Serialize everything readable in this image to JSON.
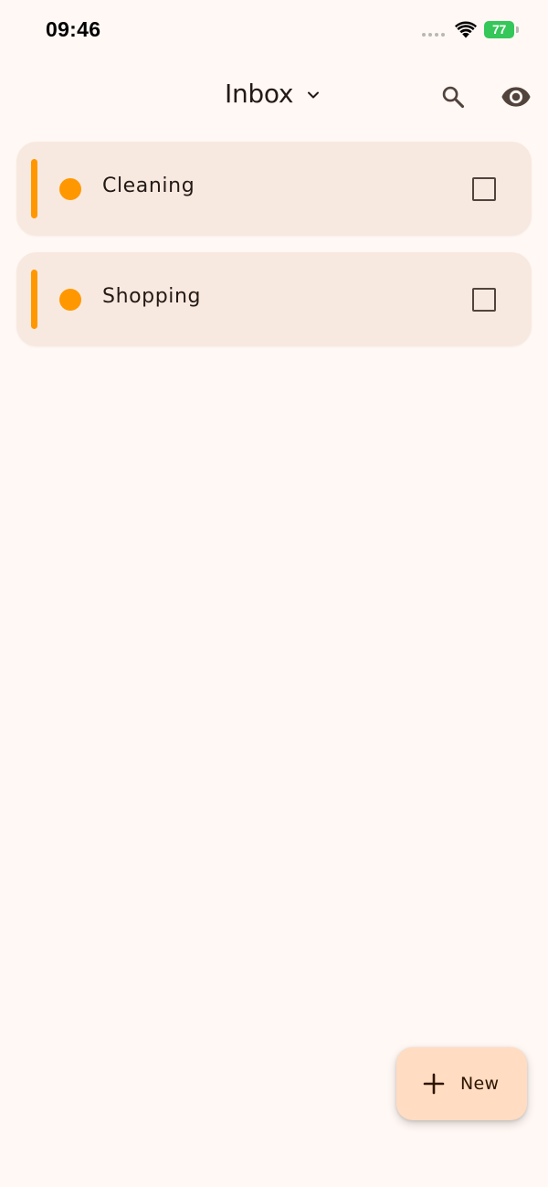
{
  "status_bar": {
    "time": "09:46",
    "battery": "77",
    "battery_color": "#35c759"
  },
  "app_bar": {
    "title": "Inbox",
    "title_dropdown_icon": "chevron-down-icon",
    "actions": [
      {
        "icon": "search-icon"
      },
      {
        "icon": "eye-icon"
      }
    ]
  },
  "lists": [
    {
      "label": "Cleaning",
      "color": "#ff9800",
      "checked": false
    },
    {
      "label": "Shopping",
      "color": "#ff9800",
      "checked": false
    }
  ],
  "fab": {
    "label": "New",
    "icon": "plus-icon",
    "color": "#ffdcc2"
  },
  "colors": {
    "background": "#fff8f4",
    "card": "#f8e9e0",
    "accent": "#ff9800",
    "text": "#231915"
  }
}
